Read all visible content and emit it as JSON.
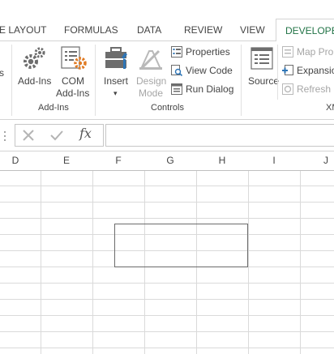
{
  "tabs": [
    {
      "label": "E LAYOUT"
    },
    {
      "label": "FORMULAS"
    },
    {
      "label": "DATA"
    },
    {
      "label": "REVIEW"
    },
    {
      "label": "VIEW"
    },
    {
      "label": "DEVELOPER"
    }
  ],
  "ribbon": {
    "addins_group": {
      "partial_label": "s",
      "addins_label": "Add-Ins",
      "com_label_1": "COM",
      "com_label_2": "Add-Ins",
      "group_label": "Add-Ins"
    },
    "controls_group": {
      "insert_label": "Insert",
      "design_label_1": "Design",
      "design_label_2": "Mode",
      "properties_label": "Properties",
      "viewcode_label": "View Code",
      "rundialog_label": "Run Dialog",
      "group_label": "Controls"
    },
    "xml_group": {
      "source_label": "Source",
      "mapprops_label": "Map Pro",
      "expansion_label": "Expansio",
      "refresh_label": "Refresh D",
      "group_label": "XM"
    }
  },
  "formula_bar": {
    "fx_label": "fx",
    "name_box_value": "",
    "formula_value": ""
  },
  "columns": [
    "D",
    "E",
    "F",
    "G",
    "H",
    "I",
    "J"
  ],
  "colors": {
    "accent": "#217346",
    "grid": "#dadada",
    "disabled": "#a6a6a6"
  }
}
